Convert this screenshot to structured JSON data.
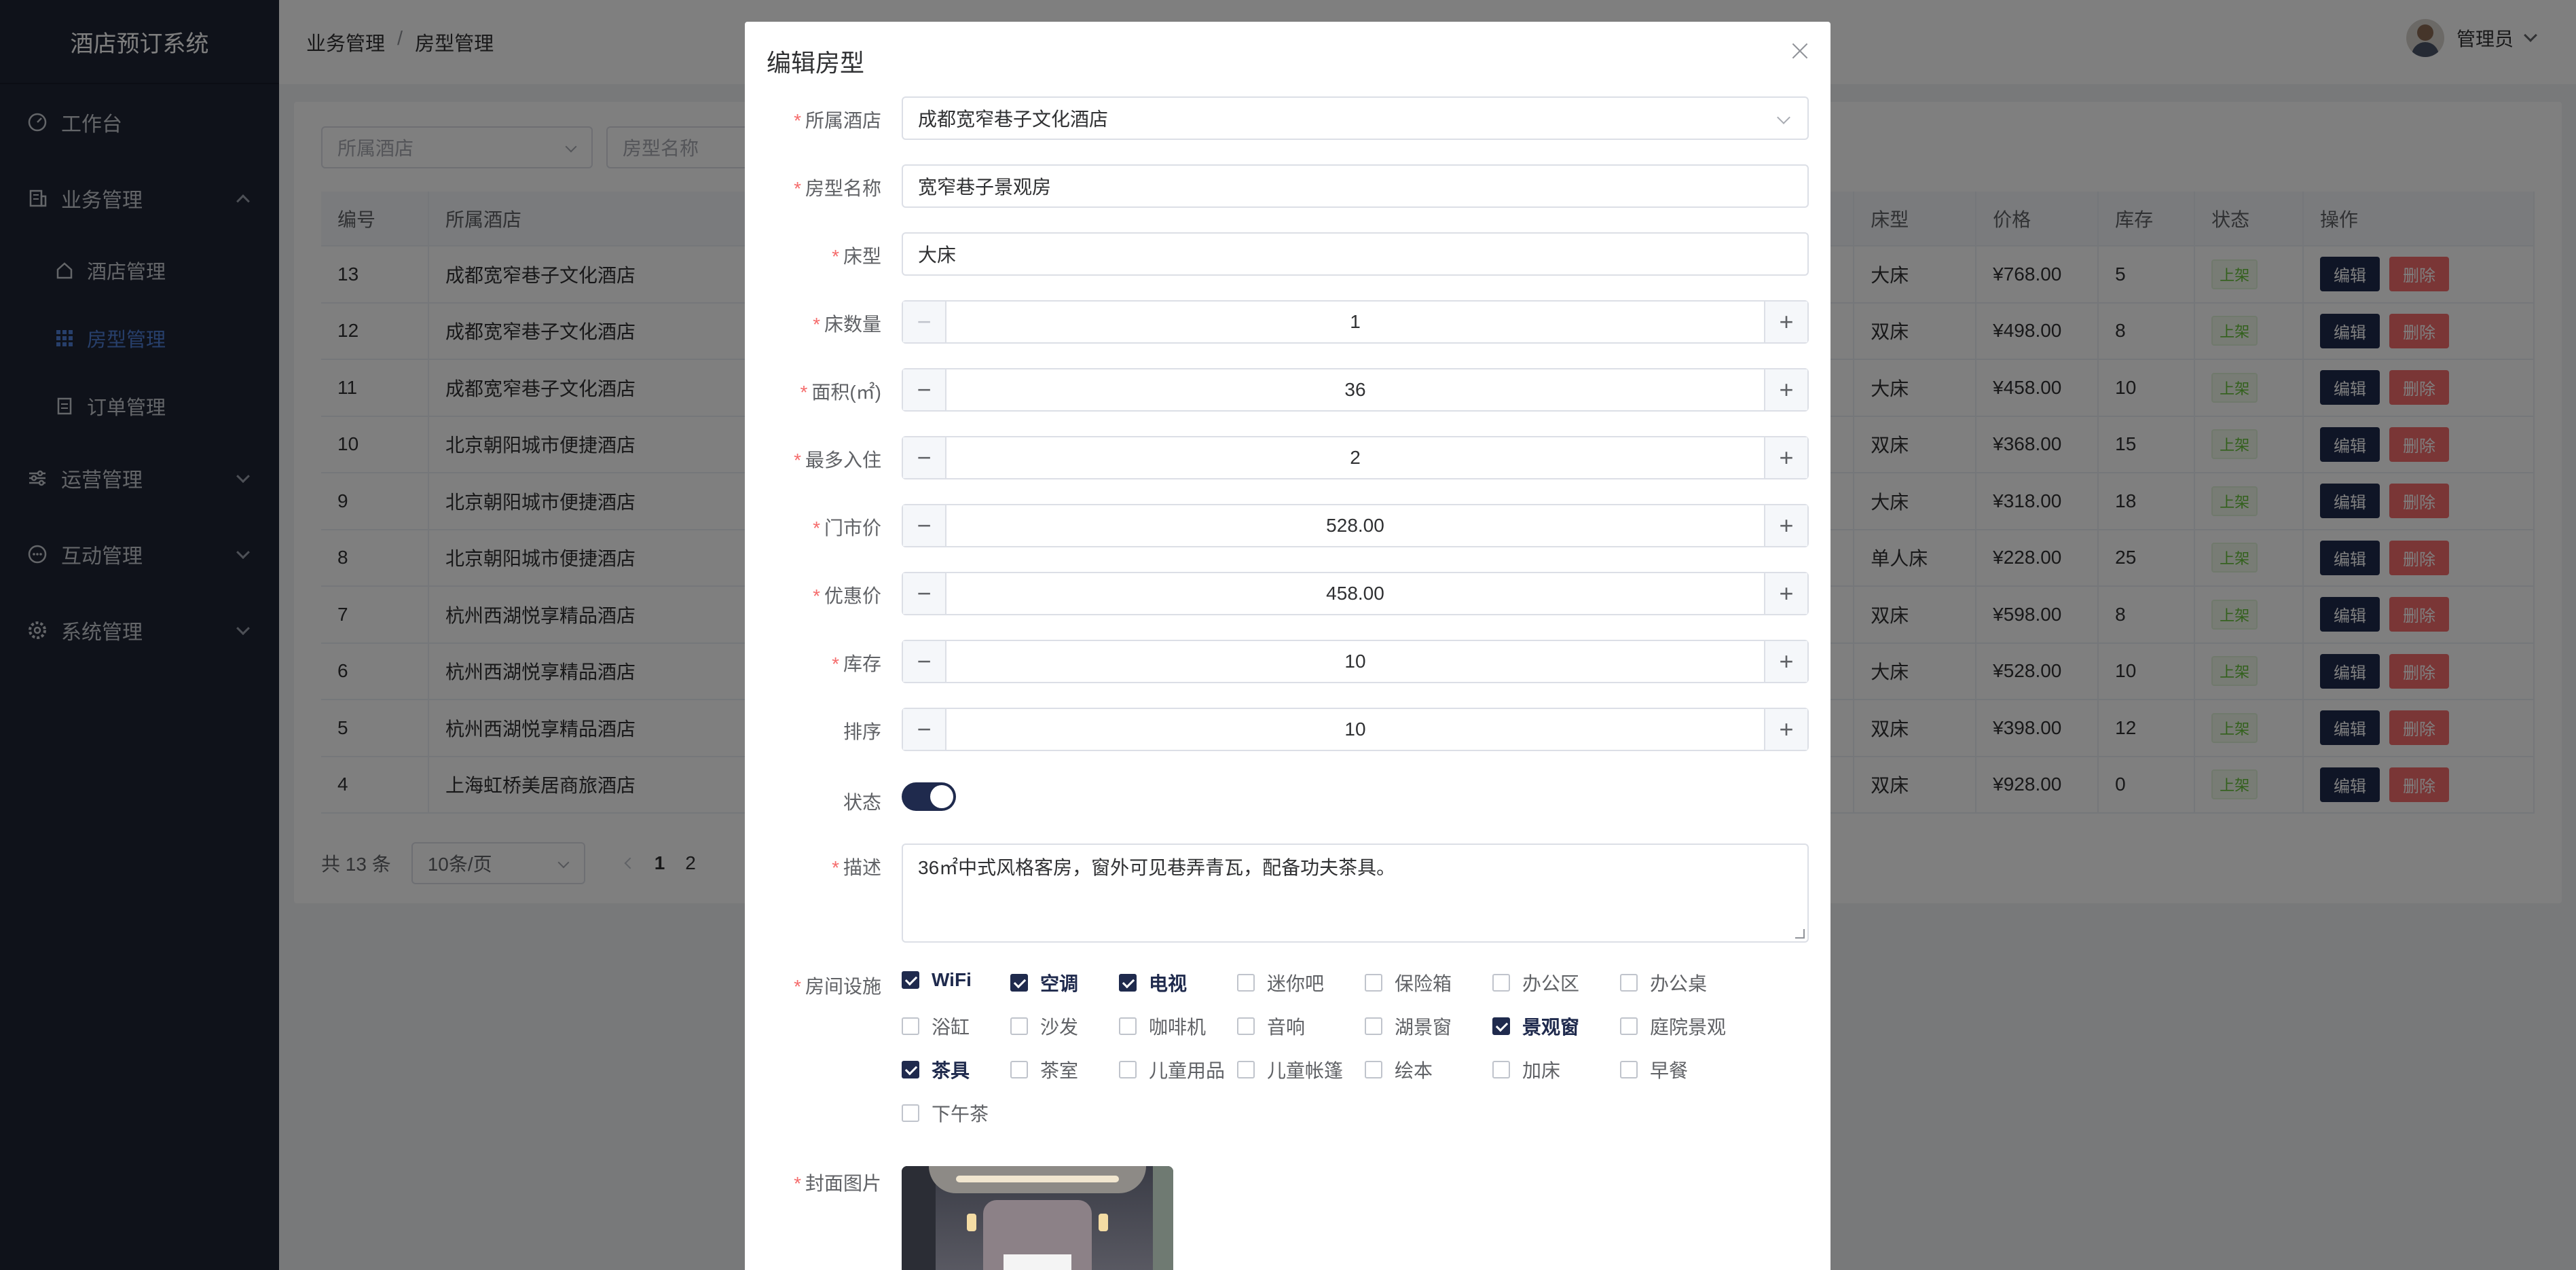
{
  "app": {
    "title": "酒店预订系统"
  },
  "sidebar": {
    "items": [
      {
        "label": "工作台"
      },
      {
        "label": "业务管理"
      },
      {
        "label": "运营管理"
      },
      {
        "label": "互动管理"
      },
      {
        "label": "系统管理"
      }
    ],
    "sub_items": [
      {
        "label": "酒店管理"
      },
      {
        "label": "房型管理"
      },
      {
        "label": "订单管理"
      }
    ]
  },
  "header": {
    "breadcrumb": [
      "业务管理",
      "/",
      "房型管理"
    ],
    "user": "管理员"
  },
  "filters": {
    "hotel_placeholder": "所属酒店",
    "room_placeholder": "房型名称"
  },
  "table": {
    "headers": [
      "编号",
      "所属酒店",
      "床型",
      "价格",
      "库存",
      "状态",
      "操作"
    ],
    "rows": [
      {
        "id": "13",
        "hotel": "成都宽窄巷子文化酒店",
        "bed": "大床",
        "price": "¥768.00",
        "stock": "5",
        "status": "上架"
      },
      {
        "id": "12",
        "hotel": "成都宽窄巷子文化酒店",
        "bed": "双床",
        "price": "¥498.00",
        "stock": "8",
        "status": "上架"
      },
      {
        "id": "11",
        "hotel": "成都宽窄巷子文化酒店",
        "bed": "大床",
        "price": "¥458.00",
        "stock": "10",
        "status": "上架"
      },
      {
        "id": "10",
        "hotel": "北京朝阳城市便捷酒店",
        "bed": "双床",
        "price": "¥368.00",
        "stock": "15",
        "status": "上架"
      },
      {
        "id": "9",
        "hotel": "北京朝阳城市便捷酒店",
        "bed": "大床",
        "price": "¥318.00",
        "stock": "18",
        "status": "上架"
      },
      {
        "id": "8",
        "hotel": "北京朝阳城市便捷酒店",
        "bed": "单人床",
        "price": "¥228.00",
        "stock": "25",
        "status": "上架"
      },
      {
        "id": "7",
        "hotel": "杭州西湖悦享精品酒店",
        "bed": "双床",
        "price": "¥598.00",
        "stock": "8",
        "status": "上架"
      },
      {
        "id": "6",
        "hotel": "杭州西湖悦享精品酒店",
        "bed": "大床",
        "price": "¥528.00",
        "stock": "10",
        "status": "上架"
      },
      {
        "id": "5",
        "hotel": "杭州西湖悦享精品酒店",
        "bed": "双床",
        "price": "¥398.00",
        "stock": "12",
        "status": "上架"
      },
      {
        "id": "4",
        "hotel": "上海虹桥美居商旅酒店",
        "bed": "双床",
        "price": "¥928.00",
        "stock": "0",
        "status": "上架"
      }
    ],
    "edit_label": "编辑",
    "delete_label": "删除"
  },
  "pagination": {
    "total": "共 13 条",
    "page_size": "10条/页",
    "pages": [
      "1",
      "2"
    ]
  },
  "dialog": {
    "title": "编辑房型",
    "fields": {
      "hotel": {
        "label": "所属酒店",
        "value": "成都宽窄巷子文化酒店"
      },
      "room_name": {
        "label": "房型名称",
        "value": "宽窄巷子景观房"
      },
      "bed_type": {
        "label": "床型",
        "value": "大床"
      },
      "bed_count": {
        "label": "床数量",
        "value": "1"
      },
      "area": {
        "label": "面积(㎡)",
        "value": "36"
      },
      "max_guests": {
        "label": "最多入住",
        "value": "2"
      },
      "market_price": {
        "label": "门市价",
        "value": "528.00"
      },
      "sale_price": {
        "label": "优惠价",
        "value": "458.00"
      },
      "stock": {
        "label": "库存",
        "value": "10"
      },
      "sort": {
        "label": "排序",
        "value": "10"
      },
      "status": {
        "label": "状态",
        "value": true
      },
      "description": {
        "label": "描述",
        "value": "36㎡中式风格客房，窗外可见巷弄青瓦，配备功夫茶具。"
      },
      "amenities_label": "房间设施",
      "cover_label": "封面图片"
    },
    "amenities": [
      {
        "label": "WiFi",
        "checked": true
      },
      {
        "label": "空调",
        "checked": true
      },
      {
        "label": "电视",
        "checked": true
      },
      {
        "label": "迷你吧",
        "checked": false
      },
      {
        "label": "保险箱",
        "checked": false
      },
      {
        "label": "办公区",
        "checked": false
      },
      {
        "label": "办公桌",
        "checked": false
      },
      {
        "label": "浴缸",
        "checked": false
      },
      {
        "label": "沙发",
        "checked": false
      },
      {
        "label": "咖啡机",
        "checked": false
      },
      {
        "label": "音响",
        "checked": false
      },
      {
        "label": "湖景窗",
        "checked": false
      },
      {
        "label": "景观窗",
        "checked": true
      },
      {
        "label": "庭院景观",
        "checked": false
      },
      {
        "label": "茶具",
        "checked": true
      },
      {
        "label": "茶室",
        "checked": false
      },
      {
        "label": "儿童用品",
        "checked": false
      },
      {
        "label": "儿童帐篷",
        "checked": false
      },
      {
        "label": "绘本",
        "checked": false
      },
      {
        "label": "加床",
        "checked": false
      },
      {
        "label": "早餐",
        "checked": false
      },
      {
        "label": "下午茶",
        "checked": false
      }
    ]
  },
  "colors": {
    "primary": "#1f2a4d",
    "sidebar_bg": "#1f2535",
    "danger": "#f56c6c",
    "success": "#67c23a",
    "active_menu": "#4e7fd6"
  }
}
